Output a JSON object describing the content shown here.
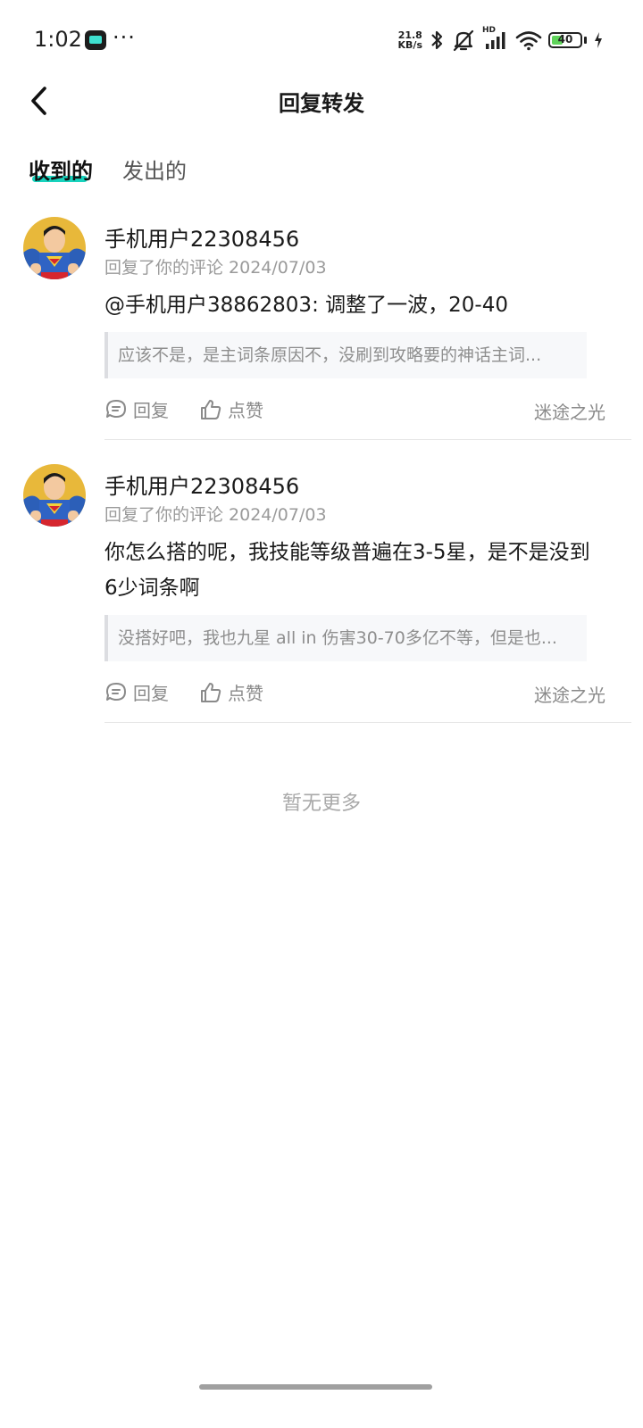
{
  "status_bar": {
    "time": "1:02",
    "net_speed_value": "21.8",
    "net_speed_unit": "KB/s",
    "hd_label": "HD",
    "battery_level": "40"
  },
  "header": {
    "title": "回复转发"
  },
  "tabs": [
    {
      "label": "收到的",
      "active": true
    },
    {
      "label": "发出的",
      "active": false
    }
  ],
  "items": [
    {
      "username": "手机用户22308456",
      "meta": "回复了你的评论 2024/07/03",
      "content": "@手机用户38862803: 调整了一波，20-40",
      "quote": "应该不是，是主词条原因不，没刷到攻略要的神话主词...",
      "reply_label": "回复",
      "like_label": "点赞",
      "source": "迷途之光"
    },
    {
      "username": "手机用户22308456",
      "meta": "回复了你的评论 2024/07/03",
      "content": "你怎么搭的呢，我技能等级普遍在3-5星，是不是没到6少词条啊",
      "quote": "没搭好吧，我也九星 all in 伤害30-70多亿不等，但是也...",
      "reply_label": "回复",
      "like_label": "点赞",
      "source": "迷途之光"
    }
  ],
  "end_text": "暂无更多",
  "colors": {
    "accent": "#17d3bd",
    "battery_fill": "#5fd35a"
  }
}
